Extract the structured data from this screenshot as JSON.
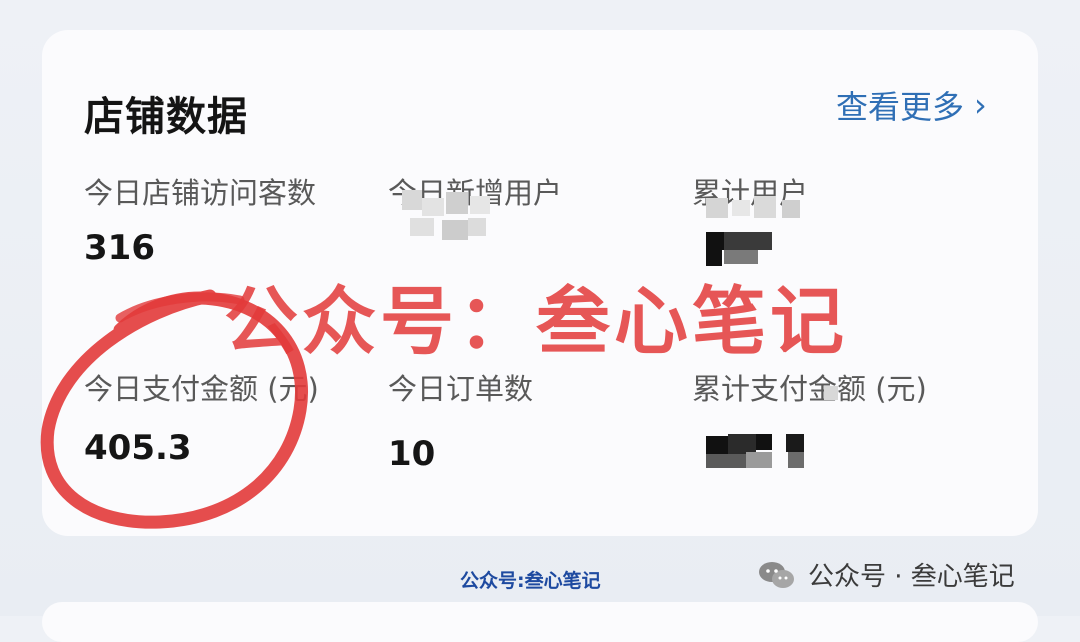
{
  "card": {
    "title": "店铺数据",
    "more_link": "查看更多",
    "metrics": [
      {
        "label": "今日店铺访问客数",
        "value": "316"
      },
      {
        "label": "今日新增用户",
        "value": ""
      },
      {
        "label": "累计用户",
        "value": ""
      },
      {
        "label": "今日支付金额 (元)",
        "value": "405.3"
      },
      {
        "label": "今日订单数",
        "value": "10"
      },
      {
        "label": "累计支付金额 (元)",
        "value": ""
      }
    ]
  },
  "watermark": "公众号：叁心笔记",
  "footer": {
    "center": "公众号:叁心笔记",
    "right": "公众号 · 叁心笔记"
  },
  "colors": {
    "accent": "#2f6fb5",
    "watermark": "#e33b3b",
    "annotation_circle": "#e23a3a"
  },
  "icons": {
    "more": "chevron-right-icon",
    "footer": "wechat-icon"
  }
}
